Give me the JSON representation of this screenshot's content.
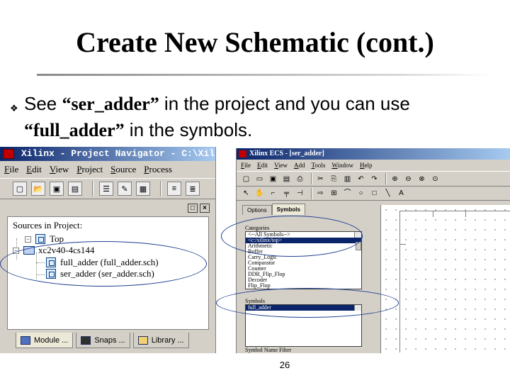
{
  "slide": {
    "title": "Create New Schematic (cont.)",
    "bullet_glyph": "❖",
    "text_part1": "See ",
    "text_quote1": "“ser_adder”",
    "text_part2": " in the project and you can use ",
    "text_quote2": "“full_adder”",
    "text_part3": " in the symbols.",
    "page_number": "26"
  },
  "navigator": {
    "title": "Xilinx - Project Navigator - C:\\Xilinx\\",
    "menu": [
      "File",
      "Edit",
      "View",
      "Project",
      "Source",
      "Process"
    ],
    "panel_buttons": [
      "□",
      "×"
    ],
    "sources_label": "Sources in Project:",
    "tree": {
      "top": "Top",
      "device": "xc2v40-4cs144",
      "item1": "full_adder (full_adder.sch)",
      "item2": "ser_adder (ser_adder.sch)"
    },
    "tabs": [
      "Module ...",
      "Snaps ...",
      "Library ..."
    ]
  },
  "ecs": {
    "title": "Xilinx ECS - [ser_adder]",
    "menu": [
      "File",
      "Edit",
      "View",
      "Add",
      "Tools",
      "Window",
      "Help"
    ],
    "tabs": [
      "Options",
      "Symbols"
    ],
    "categories_label": "Categories",
    "categories": [
      "<--All Symbols-->",
      "<c:/xilinx/top>",
      "Arithmetic",
      "Buffer",
      "Carry_Logic",
      "Comparator",
      "Counter",
      "DDR_Flip_Flop",
      "Decoder",
      "Flip_Flop"
    ],
    "categories_selected": 1,
    "symbols_label": "Symbols",
    "symbols": [
      "full_adder"
    ],
    "symbols_selected": 0,
    "symbol_filter_label": "Symbol Name Filter"
  },
  "colors": {
    "titlebar_dark": "#0a246a",
    "titlebar_light": "#a6caf0",
    "window_face": "#d4d0c8",
    "highlight_ellipse": "#1f3f8f"
  }
}
